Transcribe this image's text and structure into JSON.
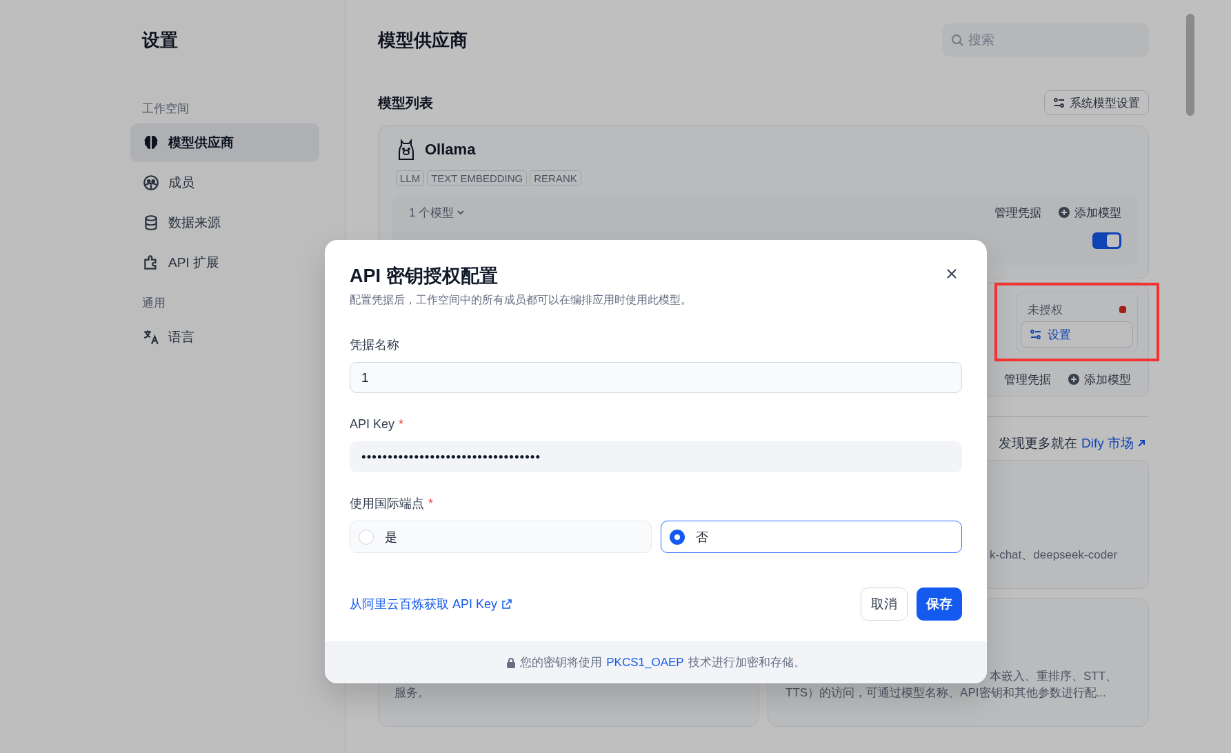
{
  "sidebar": {
    "title": "设置",
    "sections": [
      {
        "label": "工作空间",
        "items": [
          {
            "label": "模型供应商",
            "selected": true
          },
          {
            "label": "成员",
            "selected": false
          },
          {
            "label": "数据来源",
            "selected": false
          },
          {
            "label": "API 扩展",
            "selected": false
          }
        ]
      },
      {
        "label": "通用",
        "items": [
          {
            "label": "语言",
            "selected": false
          }
        ]
      }
    ]
  },
  "main": {
    "title": "模型供应商",
    "search": {
      "placeholder": "搜索"
    },
    "section_title": "模型列表",
    "system_button": "系统模型设置",
    "providers": [
      {
        "kind": "configured",
        "name": "Ollama",
        "tags": [
          "LLM",
          "TEXT EMBEDDING",
          "RERANK"
        ],
        "model_count": "1 个模型",
        "manage": "管理凭据",
        "add": "添加模型",
        "model_enabled": true
      },
      {
        "kind": "pending",
        "auth": {
          "label": "未授权",
          "authorized": false,
          "button": "设置"
        },
        "manage": "管理凭据",
        "add": "添加模型"
      }
    ],
    "marketplace": {
      "prefix": "发现更多就在",
      "link": "Dify 市场"
    },
    "cards": [
      {
        "lines": [
          "k-chat、deepseek-coder"
        ]
      },
      {
        "lines": [
          "服务。"
        ]
      },
      {
        "lines": [
          "本嵌入、重排序、STT、",
          "TTS）的访问，可通过模型名称、API密钥和其他参数进行配..."
        ]
      }
    ]
  },
  "dialog": {
    "title": "API 密钥授权配置",
    "required_mark": "*",
    "subtitle": "配置凭据后，工作空间中的所有成员都可以在编排应用时使用此模型。",
    "fields": [
      {
        "kind": "text",
        "label": "凭据名称",
        "required": false,
        "value": "1"
      },
      {
        "kind": "secret",
        "label": "API Key",
        "required": true,
        "value": "••••••••••••••••••••••••••••••••••"
      },
      {
        "kind": "radio",
        "label": "使用国际端点",
        "required": true,
        "options": [
          {
            "label": "是",
            "selected": false
          },
          {
            "label": "否",
            "selected": true
          }
        ]
      }
    ],
    "help_link": "从阿里云百炼获取 API Key",
    "buttons": [
      {
        "kind": "secondary",
        "label": "取消"
      },
      {
        "kind": "primary",
        "label": "保存"
      }
    ],
    "footer": {
      "prefix": "您的密钥将使用",
      "link": "PKCS1_OAEP",
      "suffix": "技术进行加密和存储。"
    }
  }
}
